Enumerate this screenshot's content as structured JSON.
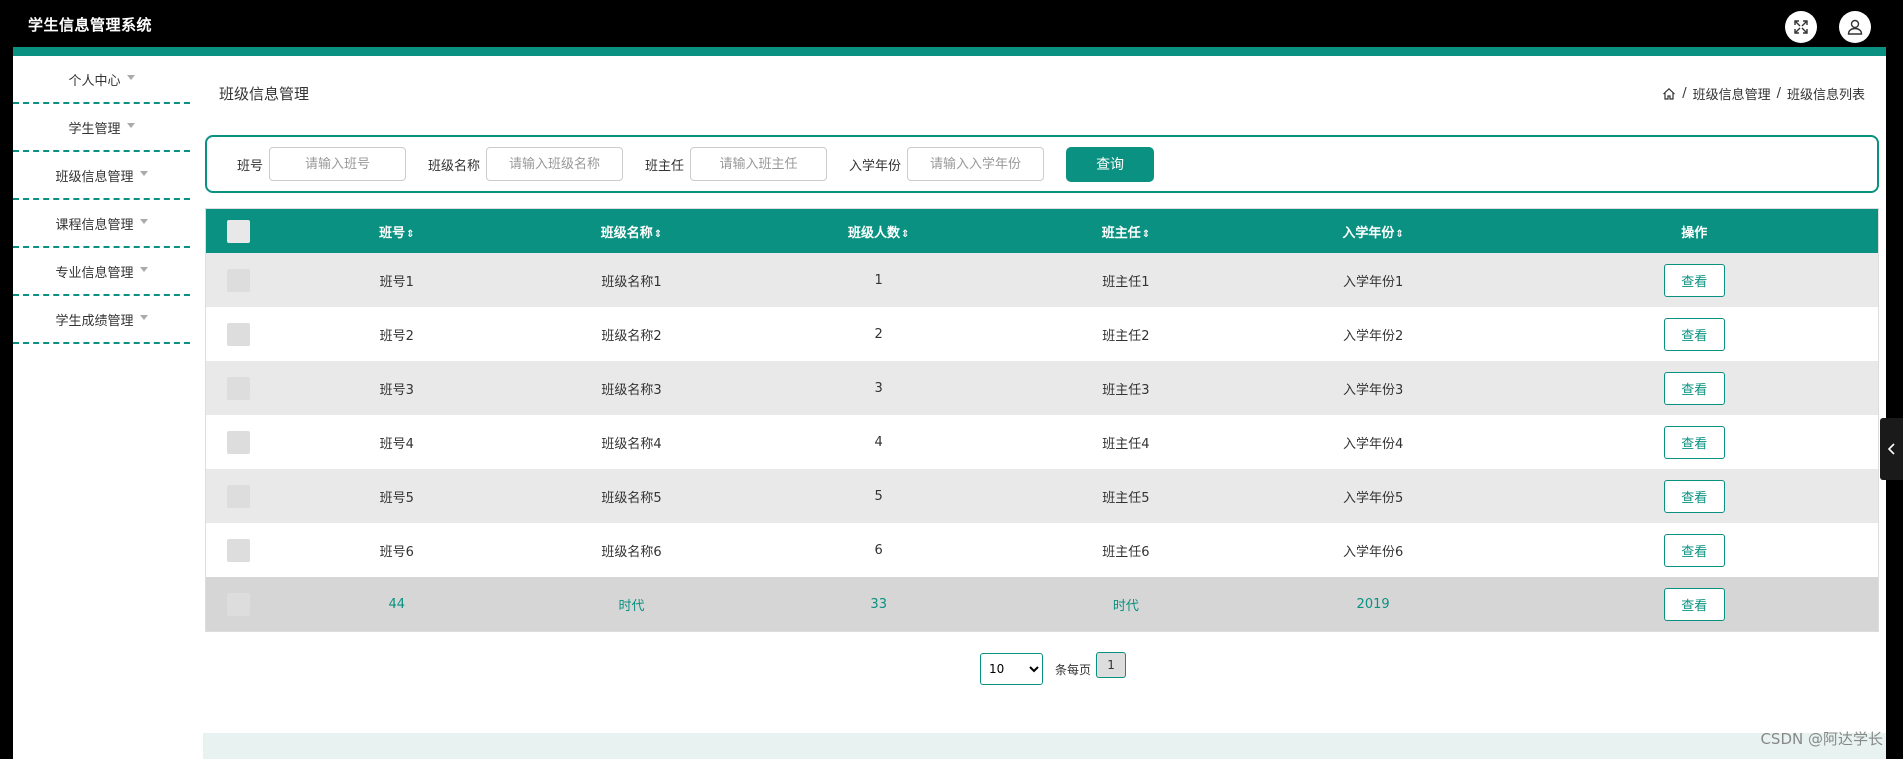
{
  "app": {
    "title": "学生信息管理系统"
  },
  "colors": {
    "accent": "#0a9181"
  },
  "icons": {
    "fullscreen": "fullscreen-icon",
    "user": "user-icon",
    "home": "home-icon"
  },
  "sidebar": {
    "items": [
      {
        "label": "个人中心"
      },
      {
        "label": "学生管理"
      },
      {
        "label": "班级信息管理"
      },
      {
        "label": "课程信息管理"
      },
      {
        "label": "专业信息管理"
      },
      {
        "label": "学生成绩管理"
      }
    ]
  },
  "main": {
    "title": "班级信息管理",
    "breadcrumb": {
      "level1": "班级信息管理",
      "level2": "班级信息列表",
      "separator": "/"
    }
  },
  "search": {
    "class_no_label": "班号",
    "class_no_placeholder": "请输入班号",
    "class_name_label": "班级名称",
    "class_name_placeholder": "请输入班级名称",
    "teacher_label": "班主任",
    "teacher_placeholder": "请输入班主任",
    "year_label": "入学年份",
    "year_placeholder": "请输入入学年份",
    "query_label": "查询"
  },
  "table": {
    "columns": {
      "class_no": "班号",
      "class_name": "班级名称",
      "count": "班级人数",
      "teacher": "班主任",
      "year": "入学年份",
      "action": "操作",
      "sort_mark": "⇕"
    },
    "view_label": "查看",
    "rows": [
      {
        "class_no": "班号1",
        "class_name": "班级名称1",
        "count": "1",
        "teacher": "班主任1",
        "year": "入学年份1"
      },
      {
        "class_no": "班号2",
        "class_name": "班级名称2",
        "count": "2",
        "teacher": "班主任2",
        "year": "入学年份2"
      },
      {
        "class_no": "班号3",
        "class_name": "班级名称3",
        "count": "3",
        "teacher": "班主任3",
        "year": "入学年份3"
      },
      {
        "class_no": "班号4",
        "class_name": "班级名称4",
        "count": "4",
        "teacher": "班主任4",
        "year": "入学年份4"
      },
      {
        "class_no": "班号5",
        "class_name": "班级名称5",
        "count": "5",
        "teacher": "班主任5",
        "year": "入学年份5"
      },
      {
        "class_no": "班号6",
        "class_name": "班级名称6",
        "count": "6",
        "teacher": "班主任6",
        "year": "入学年份6"
      },
      {
        "class_no": "44",
        "class_name": "时代",
        "count": "33",
        "teacher": "时代",
        "year": "2019"
      }
    ]
  },
  "pagination": {
    "page_size": "10",
    "per_page_label": "条每页",
    "current_page": "1"
  },
  "watermark": "CSDN @阿达学长"
}
